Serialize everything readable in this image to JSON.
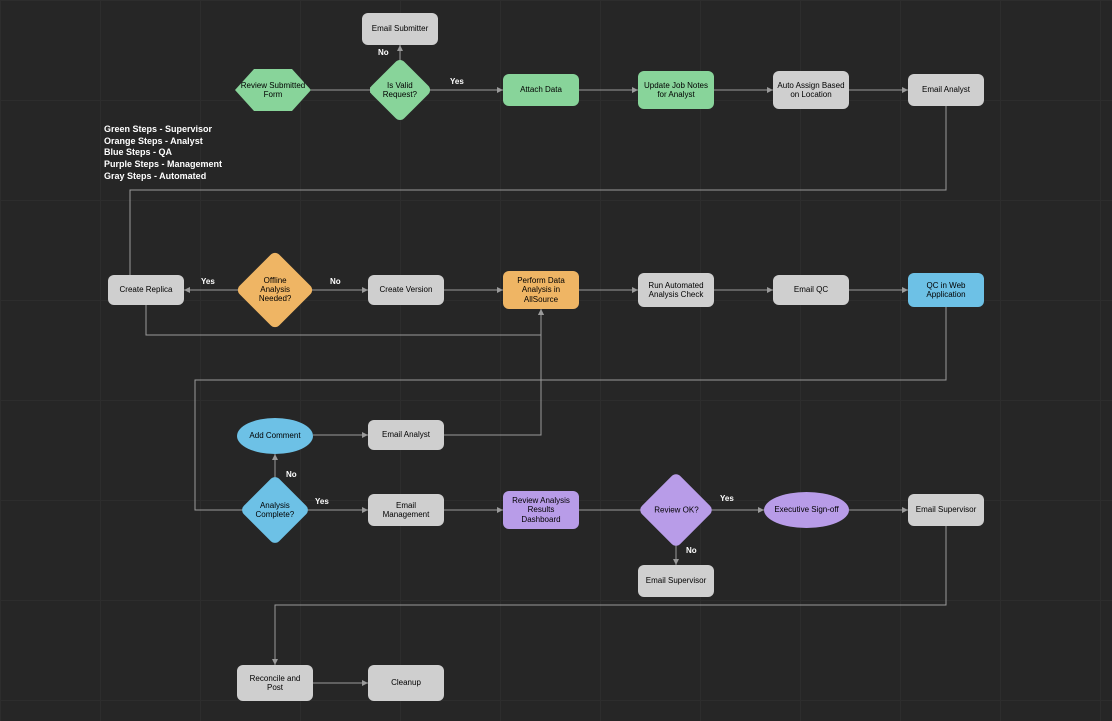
{
  "legend": {
    "line1": "Green Steps - Supervisor",
    "line2": "Orange Steps - Analyst",
    "line3": "Blue Steps - QA",
    "line4": "Purple Steps - Management",
    "line5": "Gray Steps - Automated"
  },
  "nodes": {
    "review_submitted_form": "Review Submitted Form",
    "is_valid_request": "Is Valid Request?",
    "email_submitter": "Email Submitter",
    "attach_data": "Attach Data",
    "update_job_notes": "Update Job Notes for Analyst",
    "auto_assign": "Auto Assign Based on Location",
    "email_analyst_1": "Email Analyst",
    "create_replica": "Create Replica",
    "offline_analysis_needed": "Offline Analysis Needed?",
    "create_version": "Create Version",
    "perform_data_analysis": "Perform Data Analysis in AllSource",
    "run_automated_check": "Run Automated Analysis Check",
    "email_qc": "Email QC",
    "qc_web_app": "QC in Web Application",
    "add_comment": "Add Comment",
    "email_analyst_2": "Email Analyst",
    "analysis_complete": "Analysis Complete?",
    "email_management": "Email Management",
    "review_analysis_results": "Review Analysis Results Dashboard",
    "review_ok": "Review OK?",
    "email_supervisor_2": "Email Supervisor",
    "executive_signoff": "Executive Sign-off",
    "email_supervisor_1": "Email Supervisor",
    "reconcile_and_post": "Reconcile and Post",
    "cleanup": "Cleanup"
  },
  "edge_labels": {
    "is_valid_no": "No",
    "is_valid_yes": "Yes",
    "offline_yes": "Yes",
    "offline_no": "No",
    "analysis_no": "No",
    "analysis_yes": "Yes",
    "review_yes": "Yes",
    "review_no": "No"
  },
  "chart_data": {
    "type": "flowchart",
    "title": "",
    "legend": [
      {
        "color": "green",
        "label": "Supervisor"
      },
      {
        "color": "orange",
        "label": "Analyst"
      },
      {
        "color": "blue",
        "label": "QA"
      },
      {
        "color": "purple",
        "label": "Management"
      },
      {
        "color": "gray",
        "label": "Automated"
      }
    ],
    "nodes": [
      {
        "id": "review_submitted_form",
        "label": "Review Submitted Form",
        "shape": "hexagon",
        "color": "green"
      },
      {
        "id": "is_valid_request",
        "label": "Is Valid Request?",
        "shape": "diamond",
        "color": "green"
      },
      {
        "id": "email_submitter",
        "label": "Email Submitter",
        "shape": "rect",
        "color": "gray"
      },
      {
        "id": "attach_data",
        "label": "Attach Data",
        "shape": "rect",
        "color": "green"
      },
      {
        "id": "update_job_notes",
        "label": "Update Job Notes for Analyst",
        "shape": "rect",
        "color": "green"
      },
      {
        "id": "auto_assign",
        "label": "Auto Assign Based on Location",
        "shape": "rect",
        "color": "gray"
      },
      {
        "id": "email_analyst_1",
        "label": "Email Analyst",
        "shape": "rect",
        "color": "gray"
      },
      {
        "id": "offline_analysis_needed",
        "label": "Offline Analysis Needed?",
        "shape": "diamond",
        "color": "orange"
      },
      {
        "id": "create_replica",
        "label": "Create Replica",
        "shape": "rect",
        "color": "gray"
      },
      {
        "id": "create_version",
        "label": "Create Version",
        "shape": "rect",
        "color": "gray"
      },
      {
        "id": "perform_data_analysis",
        "label": "Perform Data Analysis in AllSource",
        "shape": "rect",
        "color": "orange"
      },
      {
        "id": "run_automated_check",
        "label": "Run Automated Analysis Check",
        "shape": "rect",
        "color": "gray"
      },
      {
        "id": "email_qc",
        "label": "Email QC",
        "shape": "rect",
        "color": "gray"
      },
      {
        "id": "qc_web_app",
        "label": "QC in Web Application",
        "shape": "rect",
        "color": "blue"
      },
      {
        "id": "analysis_complete",
        "label": "Analysis Complete?",
        "shape": "diamond",
        "color": "blue"
      },
      {
        "id": "add_comment",
        "label": "Add Comment",
        "shape": "ellipse",
        "color": "blue"
      },
      {
        "id": "email_analyst_2",
        "label": "Email Analyst",
        "shape": "rect",
        "color": "gray"
      },
      {
        "id": "email_management",
        "label": "Email Management",
        "shape": "rect",
        "color": "gray"
      },
      {
        "id": "review_analysis_results",
        "label": "Review Analysis Results Dashboard",
        "shape": "rect",
        "color": "purple"
      },
      {
        "id": "review_ok",
        "label": "Review OK?",
        "shape": "diamond",
        "color": "purple"
      },
      {
        "id": "email_supervisor_2",
        "label": "Email Supervisor",
        "shape": "rect",
        "color": "gray"
      },
      {
        "id": "executive_signoff",
        "label": "Executive Sign-off",
        "shape": "ellipse",
        "color": "purple"
      },
      {
        "id": "email_supervisor_1",
        "label": "Email Supervisor",
        "shape": "rect",
        "color": "gray"
      },
      {
        "id": "reconcile_and_post",
        "label": "Reconcile and Post",
        "shape": "rect",
        "color": "gray"
      },
      {
        "id": "cleanup",
        "label": "Cleanup",
        "shape": "rect",
        "color": "gray"
      }
    ],
    "edges": [
      {
        "from": "review_submitted_form",
        "to": "is_valid_request"
      },
      {
        "from": "is_valid_request",
        "to": "email_submitter",
        "label": "No"
      },
      {
        "from": "is_valid_request",
        "to": "attach_data",
        "label": "Yes"
      },
      {
        "from": "attach_data",
        "to": "update_job_notes"
      },
      {
        "from": "update_job_notes",
        "to": "auto_assign"
      },
      {
        "from": "auto_assign",
        "to": "email_analyst_1"
      },
      {
        "from": "email_analyst_1",
        "to": "offline_analysis_needed"
      },
      {
        "from": "offline_analysis_needed",
        "to": "create_replica",
        "label": "Yes"
      },
      {
        "from": "offline_analysis_needed",
        "to": "create_version",
        "label": "No"
      },
      {
        "from": "create_replica",
        "to": "perform_data_analysis"
      },
      {
        "from": "create_version",
        "to": "perform_data_analysis"
      },
      {
        "from": "perform_data_analysis",
        "to": "run_automated_check"
      },
      {
        "from": "run_automated_check",
        "to": "email_qc"
      },
      {
        "from": "email_qc",
        "to": "qc_web_app"
      },
      {
        "from": "qc_web_app",
        "to": "analysis_complete"
      },
      {
        "from": "analysis_complete",
        "to": "add_comment",
        "label": "No"
      },
      {
        "from": "add_comment",
        "to": "email_analyst_2"
      },
      {
        "from": "email_analyst_2",
        "to": "perform_data_analysis"
      },
      {
        "from": "analysis_complete",
        "to": "email_management",
        "label": "Yes"
      },
      {
        "from": "email_management",
        "to": "review_analysis_results"
      },
      {
        "from": "review_analysis_results",
        "to": "review_ok"
      },
      {
        "from": "review_ok",
        "to": "email_supervisor_2",
        "label": "No"
      },
      {
        "from": "review_ok",
        "to": "executive_signoff",
        "label": "Yes"
      },
      {
        "from": "executive_signoff",
        "to": "email_supervisor_1"
      },
      {
        "from": "email_supervisor_1",
        "to": "reconcile_and_post"
      },
      {
        "from": "reconcile_and_post",
        "to": "cleanup"
      }
    ]
  }
}
